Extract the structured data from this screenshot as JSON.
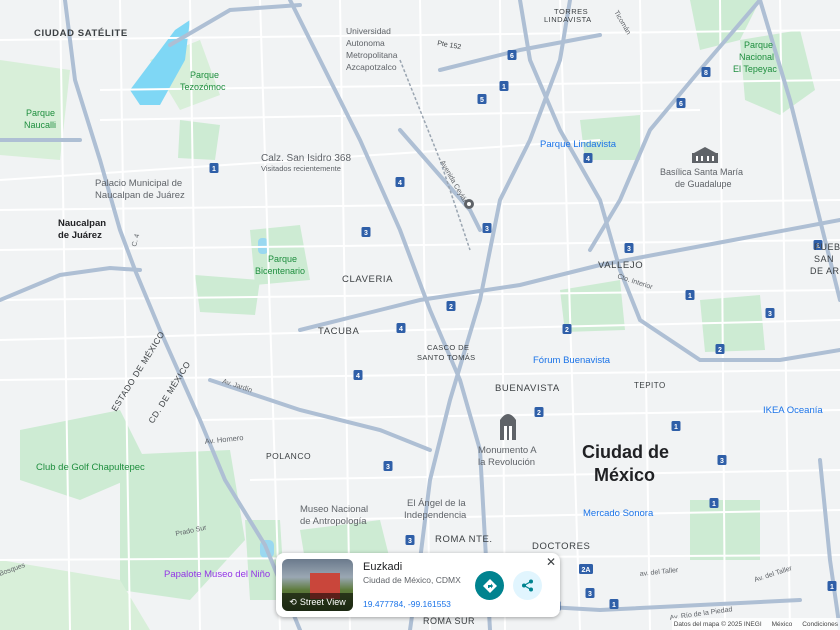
{
  "labels": {
    "ciudad_satelite": "CIUDAD SATÉLITE",
    "torres_lindavista": [
      "TORRES",
      "LINDAVISTA"
    ],
    "ticoman": "Ticomán",
    "uam": [
      "Universidad",
      "Autonoma",
      "Metropolitana",
      "Azcapotzalco"
    ],
    "pte152": "Pte 152",
    "parque_tezozomoc": [
      "Parque",
      "Tezozómoc"
    ],
    "parque_naucalli": [
      "Parque",
      "Naucalli"
    ],
    "parque_tepeyac": [
      "Parque",
      "Nacional",
      "El Tepeyac"
    ],
    "parque_lindavista": "Parque Lindavista",
    "san_isidro": "Calz. San Isidro 368",
    "visitados": "Visitados recientemente",
    "palacio_municipal": [
      "Palacio Municipal de",
      "Naucalpan de Juárez"
    ],
    "naucalpan": [
      "Naucalpan",
      "de Juárez"
    ],
    "basilica": [
      "Basílica Santa María",
      "de Guadalupe"
    ],
    "avenida_ceylan": "Avenida Ceylán",
    "vallejo": "VALLEJO",
    "claveria": "CLAVERIA",
    "parque_bicentenario": [
      "Parque",
      "Bicentenario"
    ],
    "pueb": [
      "PUEB",
      "SAN",
      "DE AR"
    ],
    "c4": "C. 4",
    "tacuba": "TACUBA",
    "casco": [
      "CASCO DE",
      "SANTO TOMÁS"
    ],
    "foro_buenavista": "Fórum Buenavista",
    "buenavista": "BUENAVISTA",
    "tepito": "TEPITO",
    "estado_mexico": "ESTADO DE MÉXICO",
    "cd_mexico": "CD. DE MÉXICO",
    "ikea": "IKEA Oceanía",
    "av_homero": "Av. Homero",
    "club_golf": "Club de Golf Chapultepec",
    "polanco": "POLANCO",
    "monumento": [
      "Monumento A",
      "la Revolución"
    ],
    "ciudad_mexico": [
      "Ciudad de",
      "México"
    ],
    "angel": [
      "El Ángel de la",
      "Independencia"
    ],
    "museo": [
      "Museo Nacional",
      "de Antropología"
    ],
    "mercado_sonora": "Mercado Sonora",
    "roma_nte": "ROMA NTE.",
    "doctores": "DOCTORES",
    "prado_sur": "Prado Sur",
    "papalote": "Papalote Museo del Niño",
    "bosques": "Bosques",
    "roma_sur": "ROMA SUR",
    "av_tallev": "av. del Taller",
    "av_del_taller": "Av. del Taller",
    "av_rio": "Av. Río de la Piedad",
    "av_jardin": "Av. Jardín",
    "circ_interior": "Cto. Interior"
  },
  "route_shields": [
    "8",
    "6",
    "5",
    "1",
    "6",
    "4",
    "4",
    "3",
    "3",
    "3",
    "2",
    "2",
    "2",
    "4",
    "4",
    "1",
    "3",
    "1",
    "2",
    "3",
    "1",
    "3",
    "2A",
    "3",
    "2",
    "3",
    "1",
    "1",
    "1",
    "2",
    "3",
    "1"
  ],
  "info_card": {
    "title": "Euzkadi",
    "subtitle": "Ciudad de México, CDMX",
    "coords": "19.477784, -99.161553",
    "street_view_label": "Street View",
    "close_label": "✕"
  },
  "attribution": {
    "data": "Datos del mapa © 2025 INEGI",
    "country": "México",
    "terms": "Condiciones"
  },
  "colors": {
    "background": "#f1f3f4",
    "park": "#c8e6c9",
    "water": "#7fd7f5",
    "arterial": "#aebfd4",
    "street": "#ffffff",
    "directions_button": "#00838f",
    "link": "#1a73e8"
  },
  "icons": {
    "basilica": "basilica-icon",
    "monument": "monument-icon",
    "pin": "map-pin-icon",
    "directions": "directions-icon",
    "share": "share-icon",
    "street_view": "street-view-icon",
    "close": "close-icon"
  }
}
